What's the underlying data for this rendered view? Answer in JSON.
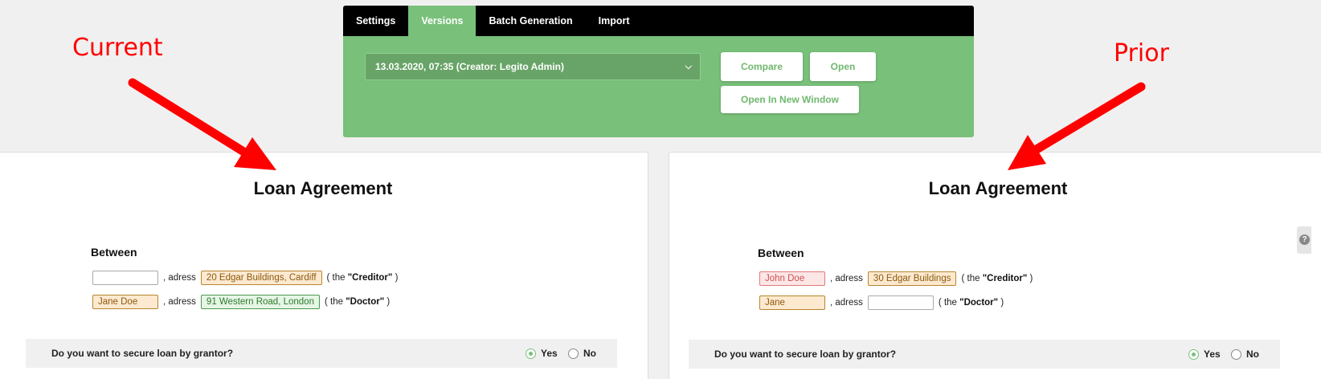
{
  "tabs": [
    {
      "label": "Settings",
      "active": false
    },
    {
      "label": "Versions",
      "active": true
    },
    {
      "label": "Batch Generation",
      "active": false
    },
    {
      "label": "Import",
      "active": false
    }
  ],
  "version_select": {
    "value": "13.03.2020, 07:35 (Creator: Legito Admin)"
  },
  "buttons": {
    "compare": "Compare",
    "open": "Open",
    "open_new_window": "Open In New Window"
  },
  "annotations": {
    "left": "Current",
    "right": "Prior",
    "color": "#ff0000"
  },
  "colors": {
    "accent": "#79c07a",
    "tab_bar": "#000000"
  },
  "current": {
    "title": "Loan Agreement",
    "between": "Between",
    "row1": {
      "field1": "",
      "adress": ", adress",
      "field2": "20 Edgar Buildings, Cardiff",
      "the": "( the",
      "role": "\"Creditor\"",
      "close": ")"
    },
    "row2": {
      "field1": "Jane Doe",
      "adress": ", adress",
      "field2": "91 Western Road, London",
      "the": "( the",
      "role": "\"Doctor\"",
      "close": ")"
    },
    "question": "Do you want to secure loan by grantor?",
    "yes": "Yes",
    "no": "No"
  },
  "prior": {
    "title": "Loan Agreement",
    "between": "Between",
    "row1": {
      "field1": "John Doe",
      "adress": ", adress",
      "field2": "30 Edgar Buildings",
      "the": "( the",
      "role": "\"Creditor\"",
      "close": ")"
    },
    "row2": {
      "field1": "Jane",
      "adress": ", adress",
      "field2": "",
      "the": "( the",
      "role": "\"Doctor\"",
      "close": ")"
    },
    "question": "Do you want to secure loan by grantor?",
    "yes": "Yes",
    "no": "No"
  },
  "help_icon": "?"
}
